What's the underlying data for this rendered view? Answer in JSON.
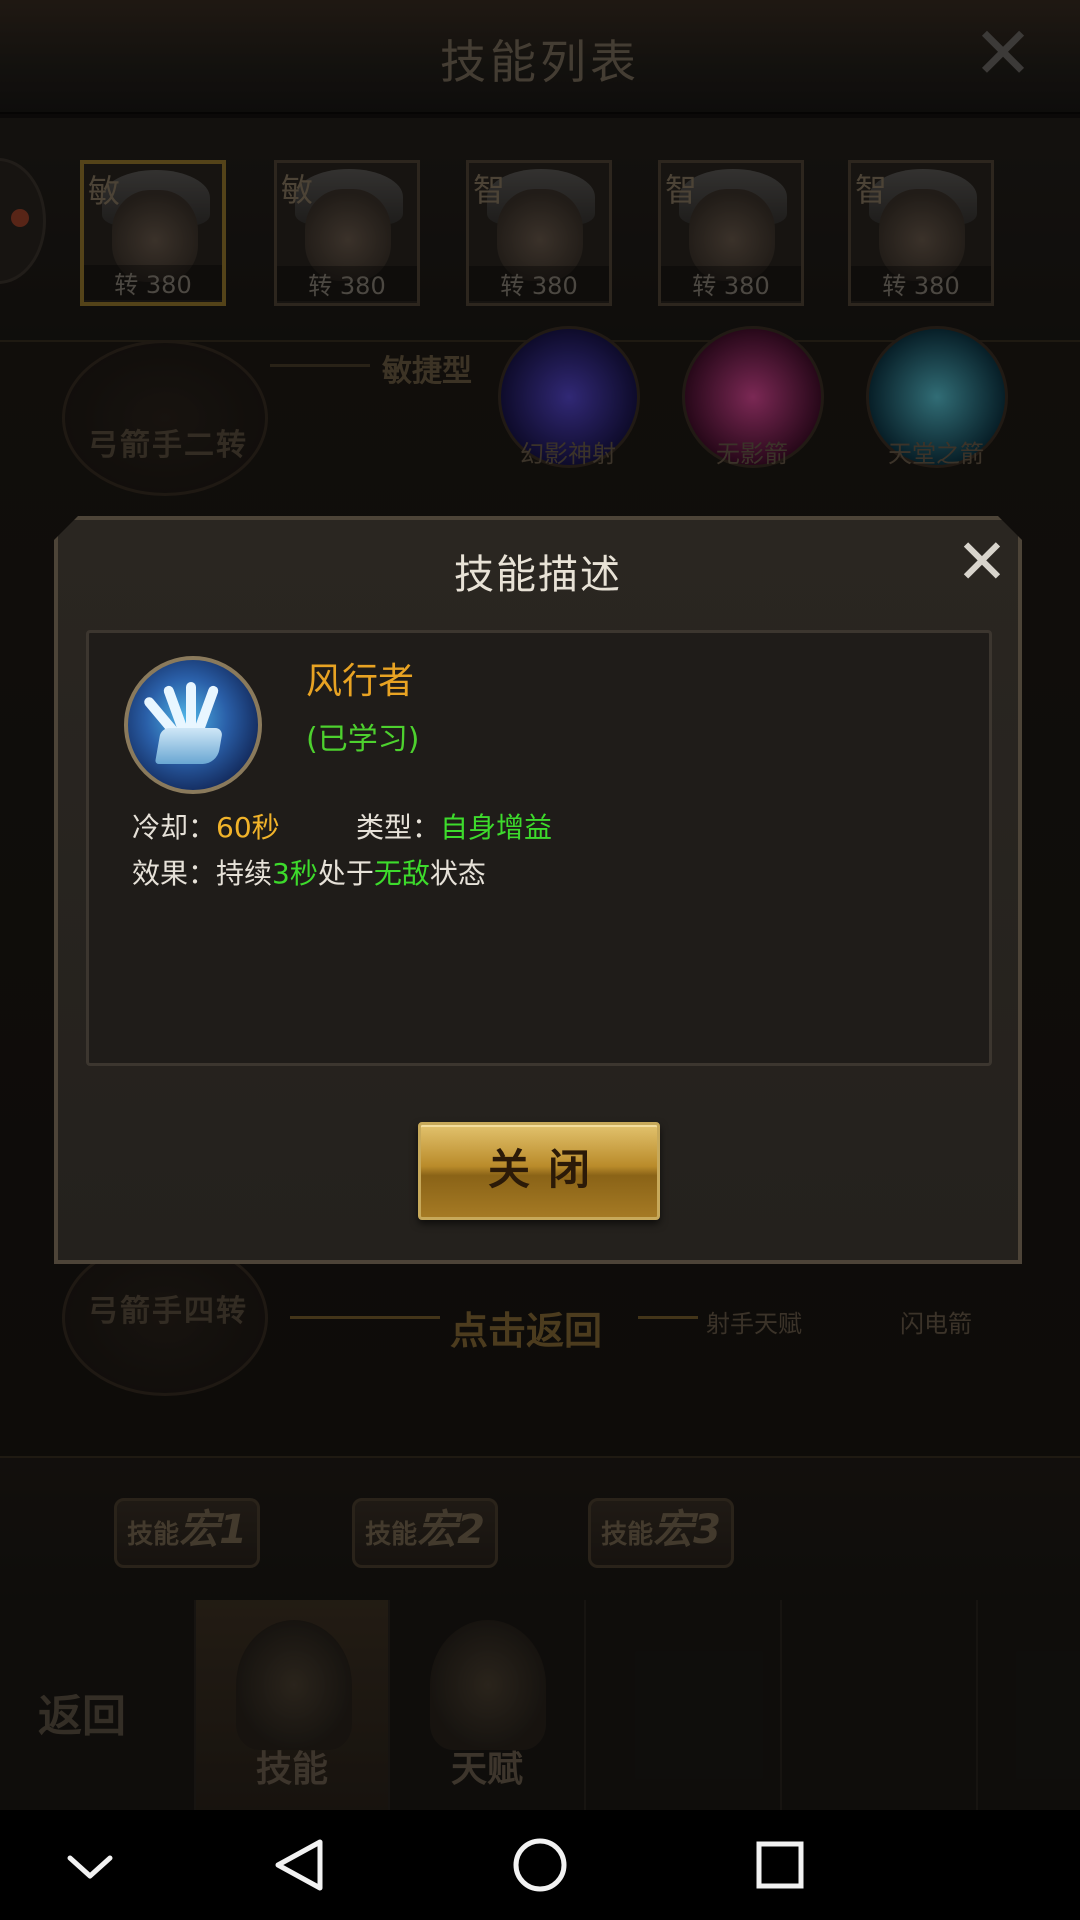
{
  "top_bar": {
    "title": "技能列表"
  },
  "characters": [
    {
      "attr": "敏",
      "level": "转 380",
      "selected": true
    },
    {
      "attr": "敏",
      "level": "转 380",
      "selected": false
    },
    {
      "attr": "智",
      "level": "转 380",
      "selected": false
    },
    {
      "attr": "智",
      "level": "转 380",
      "selected": false
    },
    {
      "attr": "智",
      "level": "转 380",
      "selected": false
    }
  ],
  "background": {
    "class_top": "弓箭手二转",
    "type_label": "敏捷型",
    "skills_top": [
      "幻影神射",
      "无影箭",
      "天堂之箭"
    ],
    "class_bottom": "弓箭手四转",
    "skills_bottom": [
      "射手天赋",
      "闪电箭"
    ],
    "return_hint": "点击返回"
  },
  "macros": [
    {
      "prefix": "技能",
      "big": "宏1"
    },
    {
      "prefix": "技能",
      "big": "宏2"
    },
    {
      "prefix": "技能",
      "big": "宏3"
    }
  ],
  "bottom_tabs": {
    "back": "返回",
    "skills": "技能",
    "talent": "天赋"
  },
  "dialog": {
    "title": "技能描述",
    "skill_name": "风行者",
    "status": "(已学习)",
    "cooldown_label": "冷却：",
    "cooldown_value": "60秒",
    "type_label": "类型：",
    "type_value": "自身增益",
    "effect_label": "效果：",
    "effect_pre": "持续",
    "effect_duration": "3秒",
    "effect_mid": "处于",
    "effect_state": "无敌",
    "effect_post": "状态",
    "close_button": "关闭"
  },
  "nav": {
    "icons": [
      "chevron-down-icon",
      "back-triangle-icon",
      "home-circle-icon",
      "recents-square-icon"
    ]
  },
  "colors": {
    "skill_name": "#e8a323",
    "learned_green": "#4dd12e",
    "value_yellow": "#f1b32a",
    "value_green": "#3ddb2c",
    "button_gold": "#b98b2a"
  }
}
